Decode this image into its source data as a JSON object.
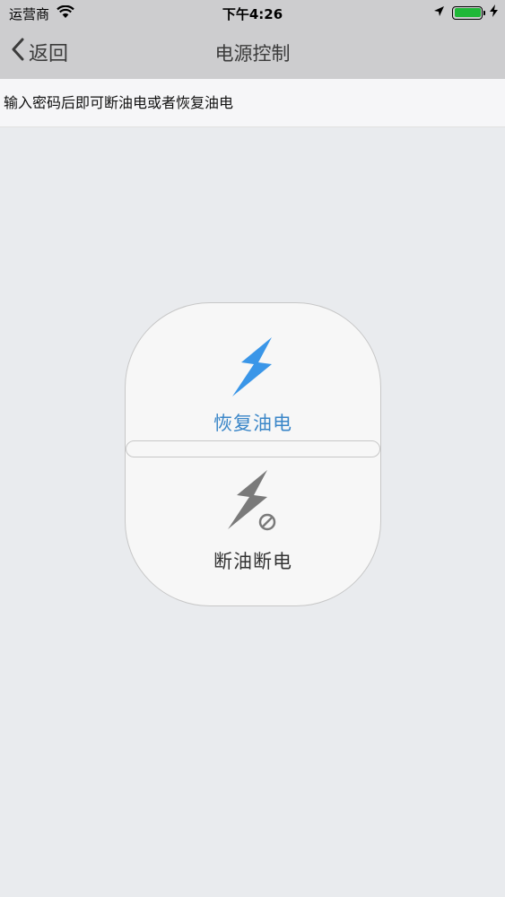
{
  "status_bar": {
    "carrier": "运营商",
    "time": "下午4:26",
    "battery_level": 1.0,
    "battery_color": "#1fb838",
    "icons": [
      "wifi-icon",
      "location-icon",
      "battery-icon",
      "charging-icon"
    ]
  },
  "nav": {
    "back_label": "返回",
    "title": "电源控制"
  },
  "hint": {
    "text": "输入密码后即可断油电或者恢复油电"
  },
  "control": {
    "restore_label": "恢复油电",
    "restore_icon": "lightning-icon",
    "restore_color": "#3a96e8",
    "cut_label": "断油断电",
    "cut_icon": "lightning-blocked-icon",
    "cut_color": "#7a7a7a"
  }
}
